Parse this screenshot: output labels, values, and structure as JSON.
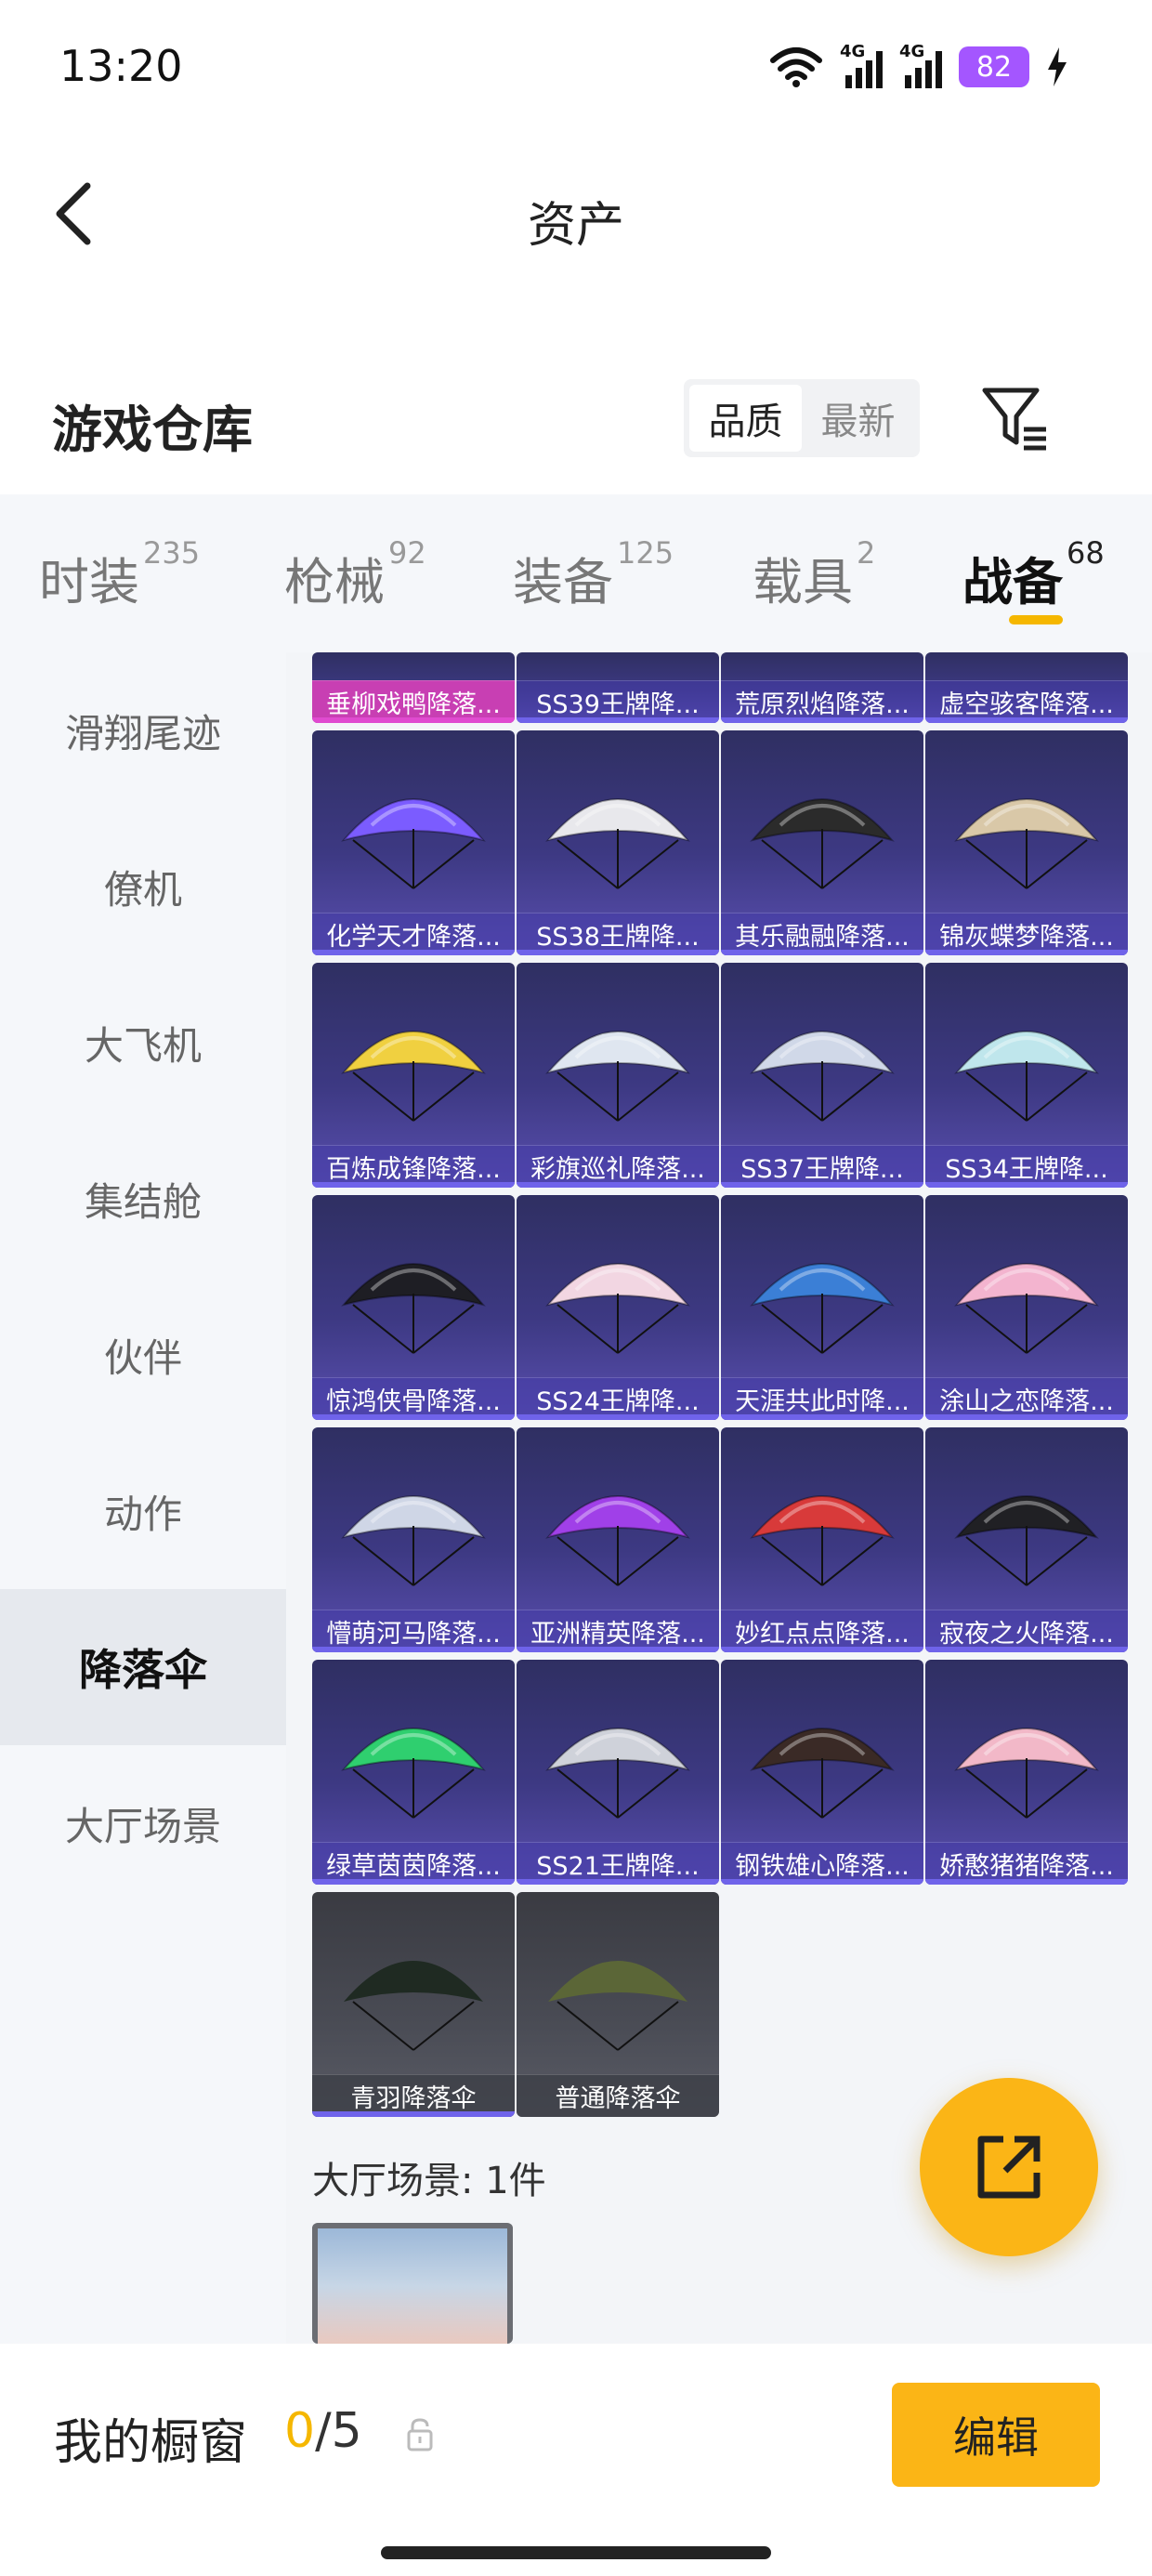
{
  "status_bar": {
    "time": "13:20",
    "network1": "4G",
    "network2": "4G",
    "battery": "82"
  },
  "nav": {
    "title": "资产"
  },
  "header": {
    "title": "游戏仓库",
    "sort_options": [
      "品质",
      "最新"
    ]
  },
  "tabs": [
    {
      "label": "时装",
      "count": "235"
    },
    {
      "label": "枪械",
      "count": "92"
    },
    {
      "label": "装备",
      "count": "125"
    },
    {
      "label": "载具",
      "count": "2"
    },
    {
      "label": "战备",
      "count": "68"
    }
  ],
  "sidebar": [
    "滑翔尾迹",
    "僚机",
    "大飞机",
    "集结舱",
    "伙伴",
    "动作",
    "降落伞",
    "大厅场景"
  ],
  "partial_row": [
    "垂柳戏鸭降落...",
    "SS39王牌降...",
    "荒原烈焰降落...",
    "虚空骇客降落..."
  ],
  "items": [
    "化学天才降落...",
    "SS38王牌降...",
    "其乐融融降落...",
    "锦灰蝶梦降落...",
    "百炼成锋降落...",
    "彩旗巡礼降落...",
    "SS37王牌降...",
    "SS34王牌降...",
    "惊鸿侠骨降落...",
    "SS24王牌降...",
    "天涯共此时降...",
    "涂山之恋降落...",
    "懵萌河马降落...",
    "亚洲精英降落...",
    "妙红点点降落...",
    "寂夜之火降落...",
    "绿草茵茵降落...",
    "SS21王牌降...",
    "钢铁雄心降落...",
    "娇憨猪猪降落..."
  ],
  "grey_items": [
    "青羽降落伞",
    "普通降落伞"
  ],
  "scene_label": "大厅场景: 1件",
  "bottom": {
    "showcase_label": "我的橱窗",
    "count_used": "0",
    "count_sep_total": "/5",
    "edit_label": "编辑"
  },
  "chute_colors": [
    "#7b5cff",
    "#e8e8ec",
    "#2b2b2b",
    "#d9c8a8",
    "#f0d040",
    "#dfe6f0",
    "#d0d8e8",
    "#bfe6ec",
    "#1e1e24",
    "#f2d6e2",
    "#3b7fd6",
    "#f3b4cf",
    "#cfd6e6",
    "#a040e8",
    "#d83a3a",
    "#202024",
    "#2fcf6f",
    "#cfd2da",
    "#3a2a26",
    "#f2b8c8"
  ],
  "grey_chute_colors": [
    "#1f2a22",
    "#5b6637"
  ]
}
